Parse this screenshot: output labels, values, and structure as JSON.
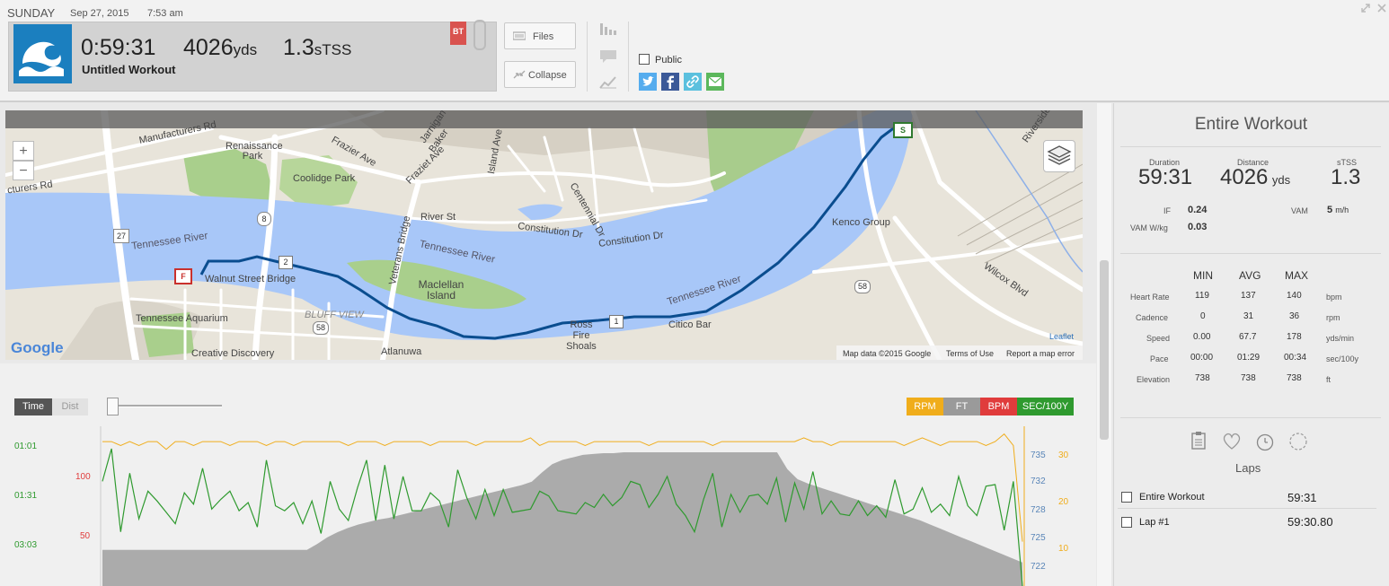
{
  "header": {
    "day": "SUNDAY",
    "date": "Sep 27, 2015",
    "time": "7:53 am",
    "duration": "0:59:31",
    "distance_value": "4026",
    "distance_unit": "yds",
    "tss_value": "1.3",
    "tss_unit": "sTSS",
    "workout_title": "Untitled Workout",
    "badge": "BT",
    "files_label": "Files",
    "collapse_label": "Collapse",
    "public_label": "Public",
    "colors": {
      "sport": "#1b7fbf",
      "badge": "#d9534f",
      "twitter": "#55acee",
      "facebook": "#3b5998",
      "link": "#5bc0de",
      "email": "#5cb85c"
    }
  },
  "map": {
    "zoom_in": "+",
    "zoom_out": "−",
    "labels": {
      "manufacturers_rd": "Manufacturers Rd",
      "manufacturers_rd_2": "cturers Rd",
      "renaissance_park": "Renaissance Park",
      "coolidge_park": "Coolidge Park",
      "frazier_ave": "Frazier Ave",
      "fraziet_ave": "Fraziet Ave",
      "island_ave": "Island Ave",
      "river_st": "River St",
      "constitution_dr": "Constitution Dr",
      "constitution_dr_2": "Constitution Dr",
      "centennial_dr": "Centennial Dr",
      "tennessee_river_1": "Tennessee River",
      "tennessee_river_2": "Tennessee River",
      "tennessee_river_3": "Tennessee River",
      "veterans_bridge": "Veterans Bridge",
      "maclellan_island": "Maclellan Island",
      "walnut_street_bridge": "Walnut Street Bridge",
      "tennessee_aquarium": "Tennessee Aquarium",
      "bluff_view": "BLUFF VIEW",
      "creative_discovery": "Creative Discovery",
      "atlanuwa": "Atlanuwa",
      "ross_fire_shoals": "Ross Fire Shoals",
      "citico_bar": "Citico Bar",
      "kenco_group": "Kenco Group",
      "wilcox_blvd": "Wilcox Blvd",
      "riverside": "Riverside",
      "jarnigan": "Jarnigan",
      "baker": "Baker",
      "route_27": "27",
      "route_8": "8",
      "route_58": "58",
      "route_58_2": "58"
    },
    "markers": {
      "start": "S",
      "finish": "F",
      "lap1": "1",
      "lap2": "2"
    },
    "google": "Google",
    "leaflet": "Leaflet",
    "map_data": "Map data ©2015 Google",
    "terms": "Terms of Use",
    "report": "Report a map error"
  },
  "chart_controls": {
    "time_label": "Time",
    "dist_label": "Dist",
    "legend": [
      {
        "label": "RPM",
        "color": "#f0ad1b"
      },
      {
        "label": "FT",
        "color": "#9a9a9a"
      },
      {
        "label": "BPM",
        "color": "#e03c3c"
      },
      {
        "label": "SEC/100Y",
        "color": "#2f9a2f"
      }
    ]
  },
  "chart_data": {
    "type": "line",
    "x_unit": "time",
    "pace_axis_ticks": [
      "01:01",
      "01:31",
      "03:03"
    ],
    "hr_axis_ticks": [
      "100",
      "50"
    ],
    "elevation_axis_ticks": [
      "735",
      "732",
      "728",
      "725",
      "722"
    ],
    "cadence_axis_ticks": [
      "30",
      "20",
      "10"
    ],
    "series": [
      {
        "name": "RPM",
        "color": "#f0ad1b",
        "values": [
          31,
          31,
          30,
          31,
          30,
          31,
          31,
          29,
          31,
          31,
          30,
          31,
          31,
          31,
          30,
          31,
          31,
          31,
          30,
          31,
          31,
          30,
          31,
          31,
          31,
          31,
          31,
          30,
          31,
          31,
          31,
          30,
          31,
          31,
          31,
          31,
          30,
          31,
          31,
          31,
          31,
          30,
          31,
          31,
          31,
          31,
          31,
          32,
          30,
          31,
          31,
          31,
          31,
          30,
          31,
          31,
          31,
          31,
          31,
          31,
          30,
          31,
          31,
          31,
          31,
          31,
          31,
          30,
          31,
          31,
          31,
          31,
          31,
          31,
          31,
          31,
          31,
          32,
          31,
          31,
          30,
          31,
          31,
          31,
          31,
          31,
          31,
          31,
          30,
          31,
          32,
          31,
          30,
          31,
          31,
          31,
          31,
          30,
          31,
          33,
          30,
          5
        ]
      },
      {
        "name": "SEC/100Y",
        "color": "#2f9a2f",
        "values": [
          60,
          40,
          91,
          55,
          83,
          66,
          72,
          79,
          86,
          67,
          74,
          52,
          77,
          71,
          66,
          78,
          73,
          88,
          47,
          75,
          78,
          73,
          86,
          72,
          92,
          60,
          77,
          84,
          64,
          47,
          84,
          50,
          83,
          57,
          78,
          78,
          67,
          72,
          88,
          53,
          70,
          83,
          65,
          81,
          65,
          79,
          78,
          77,
          66,
          69,
          78,
          79,
          80,
          73,
          76,
          68,
          75,
          70,
          60,
          62,
          76,
          68,
          57,
          74,
          81,
          91,
          71,
          55,
          88,
          68,
          79,
          69,
          68,
          74,
          58,
          85,
          61,
          77,
          54,
          80,
          72,
          80,
          81,
          72,
          81,
          75,
          82,
          59,
          80,
          77,
          64,
          79,
          74,
          81,
          57,
          75,
          81,
          63,
          62,
          90,
          60,
          0
        ]
      },
      {
        "name": "FT",
        "color": "#9a9a9a",
        "values": [
          722.3,
          722.3,
          722.3,
          722.3,
          722.3,
          722.3,
          722.3,
          722.3,
          722.3,
          722.3,
          722.3,
          722.3,
          722.3,
          722.3,
          722.3,
          722.3,
          722.3,
          722.3,
          722.3,
          722.3,
          722.3,
          723,
          723.8,
          724.4,
          724.9,
          725.3,
          725.6,
          725.9,
          726.1,
          726.4,
          726.7,
          727,
          727.3,
          727.6,
          727.9,
          728.2,
          728.5,
          728.8,
          729.1,
          729.4,
          729.7,
          730.0,
          730.4,
          731.5,
          732.5,
          733.0,
          733.3,
          733.6,
          733.7,
          733.8,
          733.8,
          733.9,
          733.9,
          733.9,
          733.9,
          733.9,
          733.9,
          733.9,
          733.9,
          733.9,
          733.9,
          733.9,
          733.9,
          733.9,
          733.9,
          733.9,
          733.9,
          731.9,
          730.7,
          730.2,
          729.8,
          729.4,
          729.0,
          728.6,
          728.2,
          727.8,
          727.4,
          727.0,
          726.6,
          726.2,
          725.8,
          725.3,
          724.8,
          724.3,
          723.8,
          723.3,
          722.8,
          722.3,
          721.8,
          721.3,
          720.8
        ]
      }
    ]
  },
  "panel": {
    "title": "Entire Workout",
    "duration_label": "Duration",
    "duration_value": "59:31",
    "distance_label": "Distance",
    "distance_value": "4026",
    "distance_unit": "yds",
    "stss_label": "sTSS",
    "stss_value": "1.3",
    "if_label": "IF",
    "if_value": "0.24",
    "vam_label": "VAM",
    "vam_value": "5",
    "vam_unit": "m/h",
    "vamwkg_label": "VAM W/kg",
    "vamwkg_value": "0.03",
    "col_min": "MIN",
    "col_avg": "AVG",
    "col_max": "MAX",
    "rows": [
      {
        "label": "Heart Rate",
        "min": "119",
        "avg": "137",
        "max": "140",
        "unit": "bpm"
      },
      {
        "label": "Cadence",
        "min": "0",
        "avg": "31",
        "max": "36",
        "unit": "rpm"
      },
      {
        "label": "Speed",
        "min": "0.00",
        "avg": "67.7",
        "max": "178",
        "unit": "yds/min"
      },
      {
        "label": "Pace",
        "min": "00:00",
        "avg": "01:29",
        "max": "00:34",
        "unit": "sec/100y"
      },
      {
        "label": "Elevation",
        "min": "738",
        "avg": "738",
        "max": "738",
        "unit": "ft"
      }
    ],
    "laps_label": "Laps",
    "laps": [
      {
        "name": "Entire Workout",
        "time": "59:31"
      },
      {
        "name": "Lap #1",
        "time": "59:30.80"
      }
    ]
  }
}
